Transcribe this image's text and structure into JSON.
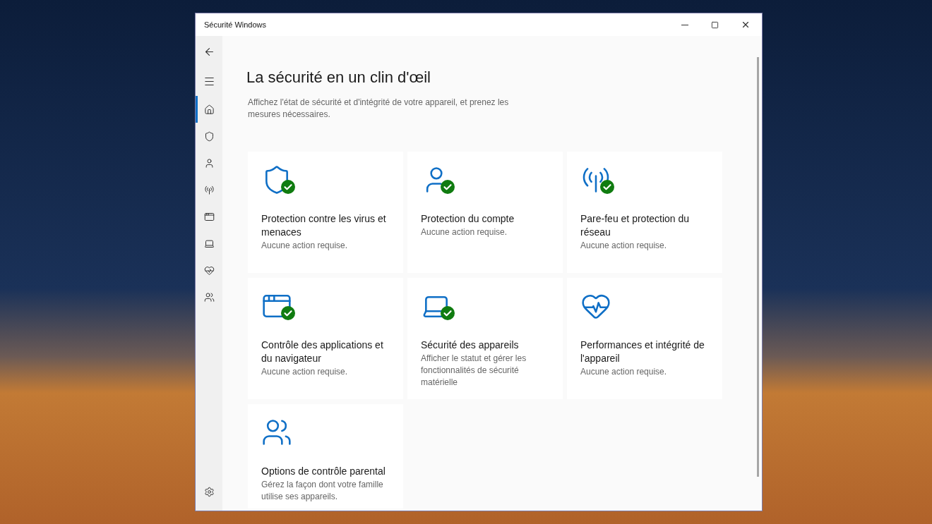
{
  "window": {
    "title": "Sécurité Windows"
  },
  "sidebar": {
    "items": [
      {
        "kind": "back",
        "selected": false
      },
      {
        "kind": "menu",
        "selected": false
      },
      {
        "kind": "home",
        "selected": true
      },
      {
        "kind": "shield",
        "selected": false
      },
      {
        "kind": "person",
        "selected": false
      },
      {
        "kind": "antenna",
        "selected": false
      },
      {
        "kind": "window",
        "selected": false
      },
      {
        "kind": "laptop",
        "selected": false
      },
      {
        "kind": "heart",
        "selected": false
      },
      {
        "kind": "family",
        "selected": false
      },
      {
        "kind": "settings",
        "selected": false
      }
    ]
  },
  "page": {
    "title": "La sécurité en un clin d'œil",
    "description": "Affichez l'état de sécurité et d'intégrité de votre appareil, et prenez les mesures nécessaires."
  },
  "cards": [
    {
      "kind": "shield",
      "ok": true,
      "title": "Protection contre les virus et menaces",
      "status": "Aucune action requise."
    },
    {
      "kind": "person",
      "ok": true,
      "title": "Protection du compte",
      "status": "Aucune action requise."
    },
    {
      "kind": "antenna",
      "ok": true,
      "title": "Pare-feu et protection du réseau",
      "status": "Aucune action requise."
    },
    {
      "kind": "window",
      "ok": true,
      "title": "Contrôle des applications et du navigateur",
      "status": "Aucune action requise."
    },
    {
      "kind": "laptop",
      "ok": true,
      "title": "Sécurité des appareils",
      "status": "Afficher le statut et gérer les fonctionnalités de sécurité matérielle"
    },
    {
      "kind": "heart",
      "ok": false,
      "title": "Performances et intégrité de l'appareil",
      "status": "Aucune action requise."
    },
    {
      "kind": "family",
      "ok": false,
      "title": "Options de contrôle parental",
      "status": "Gérez la façon dont votre famille utilise ses appareils."
    }
  ]
}
